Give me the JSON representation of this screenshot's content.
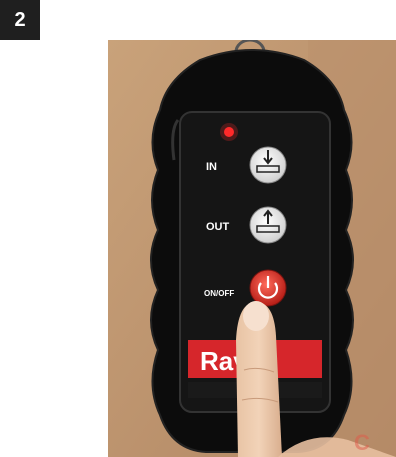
{
  "step_number": "2",
  "remote": {
    "buttons": [
      {
        "label": "IN",
        "icon": "gate-in-icon"
      },
      {
        "label": "OUT",
        "icon": "gate-out-icon"
      },
      {
        "label": "ON/OFF",
        "icon": "power-icon"
      }
    ],
    "brand": "Ravva",
    "indicator_color": "#ff2a2a",
    "brand_color": "#d6262b"
  }
}
